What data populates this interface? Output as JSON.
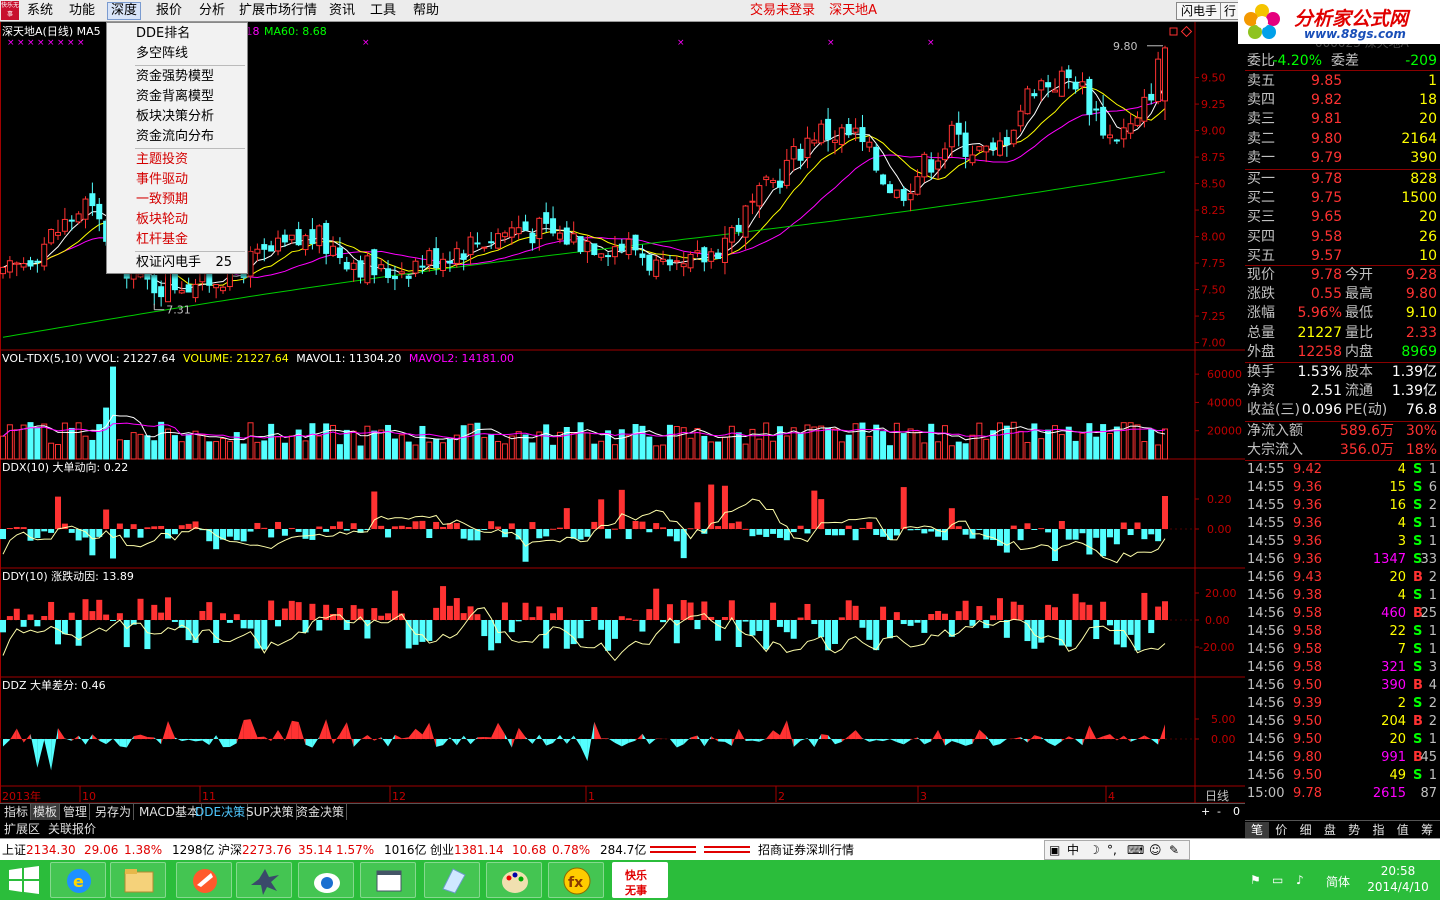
{
  "menubar": {
    "items": [
      "系统",
      "功能",
      "深度",
      "报价",
      "分析",
      "扩展市场行情",
      "资讯",
      "工具",
      "帮助"
    ],
    "logo_text": "快乐无事",
    "status_left": "交易未登录",
    "stock_name": "深天地A",
    "flash_button": "闪电手",
    "row_button": "行"
  },
  "brand": {
    "name": "分析家公式网",
    "url": "www.88gs.com"
  },
  "dropdown": {
    "items": [
      {
        "label": "DDE排名",
        "color": "black"
      },
      {
        "label": "多空阵线",
        "color": "black"
      },
      {
        "label": "资金强势模型",
        "color": "black"
      },
      {
        "label": "资金背离模型",
        "color": "black"
      },
      {
        "label": "板块决策分析",
        "color": "black"
      },
      {
        "label": "资金流向分布",
        "color": "black"
      },
      {
        "label": "主题投资",
        "color": "red"
      },
      {
        "label": "事件驱动",
        "color": "red"
      },
      {
        "label": "一致预期",
        "color": "red"
      },
      {
        "label": "板块轮动",
        "color": "red"
      },
      {
        "label": "杠杆基金",
        "color": "red"
      },
      {
        "label": "权证闪电手",
        "color": "black",
        "value": "25"
      }
    ]
  },
  "main_chart": {
    "title": "深天地A(日线)",
    "ma_label": "MA5",
    "ma_hidden": ".18",
    "ma60_label": "MA60: 8.68",
    "y_ticks": [
      "9.50",
      "9.25",
      "9.00",
      "8.75",
      "8.50",
      "8.25",
      "8.00",
      "7.75",
      "7.50",
      "7.25",
      "7.00"
    ],
    "y_range": [
      6.93,
      9.93
    ],
    "high_annotation": "9.80",
    "low_annotation": "7.31",
    "colors": {
      "up": "#ff3232",
      "down": "#54ffff",
      "ma5": "#ffffff",
      "ma10": "#ffff00",
      "ma20": "#ff00ff",
      "ma60": "#00cc00"
    }
  },
  "vol_panel": {
    "legend_name": "VOL-TDX(5,10)",
    "legend_vvol": "VVOL: 21227.64",
    "legend_volume": "VOLUME: 21227.64",
    "legend_mavol1": "MAVOL1: 11304.20",
    "legend_mavol2": "MAVOL2: 14181.00",
    "y_ticks": [
      "60000",
      "40000",
      "20000"
    ]
  },
  "ddx_panel": {
    "legend": "DDX(10) 大单动向: 0.22",
    "y_ticks": [
      "0.20",
      "0.00"
    ]
  },
  "ddy_panel": {
    "legend": "DDY(10) 涨跌动因: 13.89",
    "y_ticks": [
      "20.00",
      "0.00",
      "-20.00"
    ]
  },
  "ddz_panel": {
    "legend": "DDZ 大单差分: 0.46",
    "y_ticks": [
      "5.00",
      "0.00"
    ]
  },
  "x_axis": {
    "labels": [
      "2013年",
      "10",
      "11",
      "12",
      "1",
      "2",
      "3",
      "4"
    ],
    "period_label": "日线"
  },
  "quote": {
    "header_faded": "000023 深天地A",
    "wb": {
      "l1": "委比",
      "v1": "-4.20%",
      "l2": "委差",
      "v2": "-209"
    },
    "asks": [
      {
        "label": "卖五",
        "price": "9.85",
        "vol": "1"
      },
      {
        "label": "卖四",
        "price": "9.82",
        "vol": "18"
      },
      {
        "label": "卖三",
        "price": "9.81",
        "vol": "20"
      },
      {
        "label": "卖二",
        "price": "9.80",
        "vol": "2164"
      },
      {
        "label": "卖一",
        "price": "9.79",
        "vol": "390"
      }
    ],
    "bids": [
      {
        "label": "买一",
        "price": "9.78",
        "vol": "828"
      },
      {
        "label": "买二",
        "price": "9.75",
        "vol": "1500"
      },
      {
        "label": "买三",
        "price": "9.65",
        "vol": "20"
      },
      {
        "label": "买四",
        "price": "9.58",
        "vol": "26"
      },
      {
        "label": "买五",
        "price": "9.57",
        "vol": "10"
      }
    ],
    "stats": [
      {
        "l1": "现价",
        "v1": "9.78",
        "c1": "#ff3232",
        "l2": "今开",
        "v2": "9.28",
        "c2": "#ff3232"
      },
      {
        "l1": "涨跌",
        "v1": "0.55",
        "c1": "#ff3232",
        "l2": "最高",
        "v2": "9.80",
        "c2": "#ff3232"
      },
      {
        "l1": "涨幅",
        "v1": "5.96%",
        "c1": "#ff3232",
        "l2": "最低",
        "v2": "9.10",
        "c2": "#ffff00"
      },
      {
        "l1": "总量",
        "v1": "21227",
        "c1": "#ffff00",
        "l2": "量比",
        "v2": "2.33",
        "c2": "#ff3232"
      },
      {
        "l1": "外盘",
        "v1": "12258",
        "c1": "#ff3232",
        "l2": "内盘",
        "v2": "8969",
        "c2": "#00ff00"
      }
    ],
    "stats2": [
      {
        "l1": "换手",
        "v1": "1.53%",
        "c1": "#ffffff",
        "l2": "股本",
        "v2": "1.39亿",
        "c2": "#ffffff"
      },
      {
        "l1": "净资",
        "v1": "2.51",
        "c1": "#ffffff",
        "l2": "流通",
        "v2": "1.39亿",
        "c2": "#ffffff"
      },
      {
        "l1": "收益(三)",
        "v1": "0.096",
        "c1": "#ffffff",
        "l2": "PE(动)",
        "v2": "76.8",
        "c2": "#ffffff"
      }
    ],
    "flows": [
      {
        "l": "净流入额",
        "v": "589.6万",
        "p": "30%"
      },
      {
        "l": "大宗流入",
        "v": "356.0万",
        "p": "18%"
      }
    ]
  },
  "ticks": [
    {
      "time": "14:55",
      "price": "9.42",
      "vol": "4",
      "bs": "S",
      "n": "1"
    },
    {
      "time": "14:55",
      "price": "9.36",
      "vol": "15",
      "bs": "S",
      "n": "6"
    },
    {
      "time": "14:55",
      "price": "9.36",
      "vol": "16",
      "bs": "S",
      "n": "2"
    },
    {
      "time": "14:55",
      "price": "9.36",
      "vol": "4",
      "bs": "S",
      "n": "1"
    },
    {
      "time": "14:55",
      "price": "9.36",
      "vol": "3",
      "bs": "S",
      "n": "1"
    },
    {
      "time": "14:56",
      "price": "9.36",
      "vol": "1347",
      "bs": "S",
      "n": "33"
    },
    {
      "time": "14:56",
      "price": "9.43",
      "vol": "20",
      "bs": "B",
      "n": "2"
    },
    {
      "time": "14:56",
      "price": "9.38",
      "vol": "4",
      "bs": "S",
      "n": "1"
    },
    {
      "time": "14:56",
      "price": "9.58",
      "vol": "460",
      "bs": "B",
      "n": "25"
    },
    {
      "time": "14:56",
      "price": "9.58",
      "vol": "22",
      "bs": "S",
      "n": "1"
    },
    {
      "time": "14:56",
      "price": "9.58",
      "vol": "7",
      "bs": "S",
      "n": "1"
    },
    {
      "time": "14:56",
      "price": "9.58",
      "vol": "321",
      "bs": "S",
      "n": "3"
    },
    {
      "time": "14:56",
      "price": "9.50",
      "vol": "390",
      "bs": "B",
      "n": "4"
    },
    {
      "time": "14:56",
      "price": "9.39",
      "vol": "2",
      "bs": "S",
      "n": "2"
    },
    {
      "time": "14:56",
      "price": "9.50",
      "vol": "204",
      "bs": "B",
      "n": "2"
    },
    {
      "time": "14:56",
      "price": "9.50",
      "vol": "20",
      "bs": "S",
      "n": "1"
    },
    {
      "time": "14:56",
      "price": "9.80",
      "vol": "991",
      "bs": "B",
      "n": "45"
    },
    {
      "time": "14:56",
      "price": "9.50",
      "vol": "49",
      "bs": "S",
      "n": "1"
    },
    {
      "time": "15:00",
      "price": "9.78",
      "vol": "2615",
      "bs": "",
      "n": "87"
    }
  ],
  "right_tabs": [
    "笔",
    "价",
    "细",
    "盘",
    "势",
    "指",
    "值",
    "筹"
  ],
  "bottom_tabs": [
    {
      "label": "指标",
      "active": false,
      "cyan": false
    },
    {
      "label": "模板",
      "active": true,
      "cyan": false
    },
    {
      "label": "管理",
      "active": false,
      "cyan": false
    },
    {
      "label": "另存为",
      "active": false,
      "cyan": false
    },
    {
      "label": "MACD基本",
      "active": false,
      "cyan": false
    },
    {
      "label": "DDE决策",
      "active": false,
      "cyan": true
    },
    {
      "label": "SUP决策",
      "active": false,
      "cyan": false
    },
    {
      "label": "资金决策",
      "active": false,
      "cyan": false
    }
  ],
  "bottom_tabs2": [
    "扩展区",
    "关联报价"
  ],
  "scroll_ctl": {
    "plus": "+",
    "minus": "-",
    "zero": "0"
  },
  "statusbar": {
    "sh_label": "上证",
    "sh_val": "2134.30",
    "sh_chg": "29.06",
    "sh_pct": "1.38%",
    "sh_amt": "1298亿",
    "hs_label": "沪深",
    "hs_val": "2273.76",
    "hs_chg": "35.14",
    "hs_pct": "1.57%",
    "hs_amt": "1016亿",
    "cy_label": "创业",
    "cy_val": "1381.14",
    "cy_chg": "10.68",
    "cy_pct": "0.78%",
    "cy_amt": "284.7亿",
    "broker": "招商证券深圳行情",
    "ime_lang": "中"
  },
  "taskbar": {
    "tray_lang": "简体",
    "time": "20:58",
    "date": "2014/4/10"
  }
}
